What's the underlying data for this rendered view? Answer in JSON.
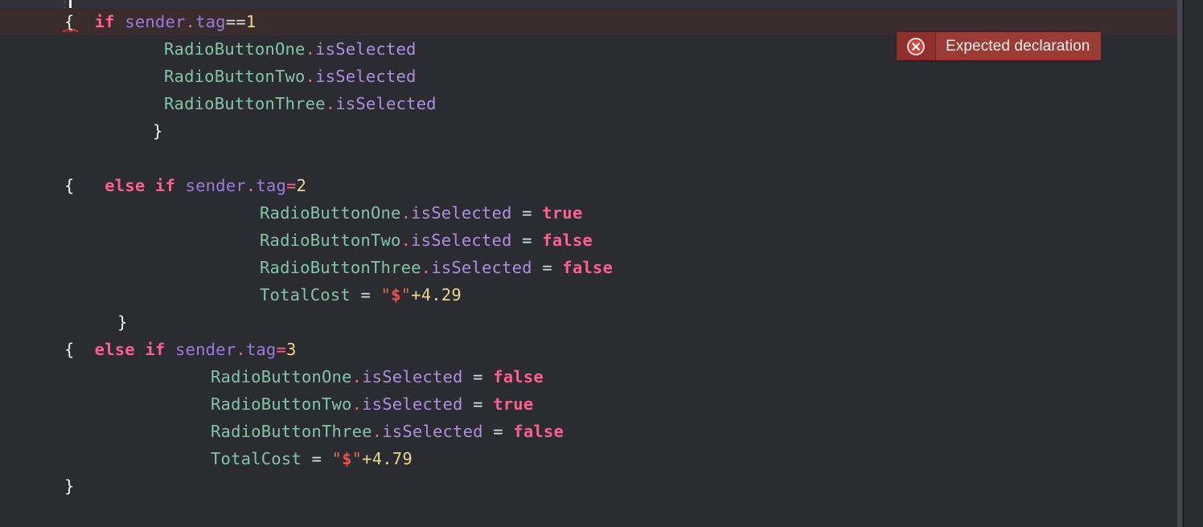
{
  "editor": {
    "background_color": "#2a2c31",
    "error_line_background": "#3a2b2d",
    "caret_color": "#f2f2f2"
  },
  "error_badge": {
    "icon": "error-circle-x-icon",
    "message": "Expected declaration",
    "icon_background": "#8f2f2c",
    "text_background": "#9a3b36",
    "text_color": "#fbeeed"
  },
  "code": {
    "language": "swift",
    "lines": [
      {
        "id": "line-1",
        "error": true,
        "indent": 0,
        "tokens": [
          {
            "t": "{",
            "c": "brace",
            "squiggle": true
          },
          {
            "t": "  ",
            "c": "plain"
          },
          {
            "t": "if",
            "c": "kw"
          },
          {
            "t": " ",
            "c": "plain"
          },
          {
            "t": "sender",
            "c": "ident"
          },
          {
            "t": ".",
            "c": "punct"
          },
          {
            "t": "tag",
            "c": "ident"
          },
          {
            "t": "==",
            "c": "op"
          },
          {
            "t": "1",
            "c": "num"
          }
        ]
      },
      {
        "id": "line-2",
        "error": false,
        "indent": 124,
        "tokens": [
          {
            "t": "RadioButtonOne",
            "c": "type"
          },
          {
            "t": ".",
            "c": "punct"
          },
          {
            "t": "isSelected",
            "c": "prop"
          }
        ]
      },
      {
        "id": "line-3",
        "error": false,
        "indent": 124,
        "tokens": [
          {
            "t": "RadioButtonTwo",
            "c": "type"
          },
          {
            "t": ".",
            "c": "punct"
          },
          {
            "t": "isSelected",
            "c": "prop"
          }
        ]
      },
      {
        "id": "line-4",
        "error": false,
        "indent": 124,
        "tokens": [
          {
            "t": "RadioButtonThree",
            "c": "type"
          },
          {
            "t": ".",
            "c": "punct"
          },
          {
            "t": "isSelected",
            "c": "prop"
          }
        ]
      },
      {
        "id": "line-5",
        "error": false,
        "indent": 110,
        "tokens": [
          {
            "t": "}",
            "c": "brace"
          }
        ]
      },
      {
        "id": "line-6",
        "error": false,
        "indent": 0,
        "tokens": []
      },
      {
        "id": "line-7",
        "error": false,
        "indent": 0,
        "tokens": [
          {
            "t": "{",
            "c": "brace"
          },
          {
            "t": "   ",
            "c": "plain"
          },
          {
            "t": "else",
            "c": "kw"
          },
          {
            "t": " ",
            "c": "plain"
          },
          {
            "t": "if",
            "c": "kw"
          },
          {
            "t": " ",
            "c": "plain"
          },
          {
            "t": "sender",
            "c": "ident"
          },
          {
            "t": ".",
            "c": "punct"
          },
          {
            "t": "tag",
            "c": "ident"
          },
          {
            "t": "=",
            "c": "punct"
          },
          {
            "t": "2",
            "c": "num"
          }
        ]
      },
      {
        "id": "line-8",
        "error": false,
        "indent": 243,
        "tokens": [
          {
            "t": "RadioButtonOne",
            "c": "type"
          },
          {
            "t": ".",
            "c": "punct"
          },
          {
            "t": "isSelected",
            "c": "prop"
          },
          {
            "t": " ",
            "c": "plain"
          },
          {
            "t": "=",
            "c": "op"
          },
          {
            "t": " ",
            "c": "plain"
          },
          {
            "t": "true",
            "c": "bool"
          }
        ]
      },
      {
        "id": "line-9",
        "error": false,
        "indent": 243,
        "tokens": [
          {
            "t": "RadioButtonTwo",
            "c": "type"
          },
          {
            "t": ".",
            "c": "punct"
          },
          {
            "t": "isSelected",
            "c": "prop"
          },
          {
            "t": " ",
            "c": "plain"
          },
          {
            "t": "=",
            "c": "op"
          },
          {
            "t": " ",
            "c": "plain"
          },
          {
            "t": "false",
            "c": "bool"
          }
        ]
      },
      {
        "id": "line-10",
        "error": false,
        "indent": 243,
        "tokens": [
          {
            "t": "RadioButtonThree",
            "c": "type"
          },
          {
            "t": ".",
            "c": "punct"
          },
          {
            "t": "isSelected",
            "c": "prop"
          },
          {
            "t": " ",
            "c": "plain"
          },
          {
            "t": "=",
            "c": "op"
          },
          {
            "t": " ",
            "c": "plain"
          },
          {
            "t": "false",
            "c": "bool"
          }
        ]
      },
      {
        "id": "line-11",
        "error": false,
        "indent": 243,
        "tokens": [
          {
            "t": "TotalCost",
            "c": "type"
          },
          {
            "t": " ",
            "c": "plain"
          },
          {
            "t": "=",
            "c": "op"
          },
          {
            "t": " ",
            "c": "plain"
          },
          {
            "t": "\"",
            "c": "str"
          },
          {
            "t": "$",
            "c": "dollar"
          },
          {
            "t": "\"",
            "c": "str"
          },
          {
            "t": "+4.29",
            "c": "num"
          }
        ]
      },
      {
        "id": "line-12",
        "error": false,
        "indent": 66,
        "tokens": [
          {
            "t": "}",
            "c": "brace"
          }
        ]
      },
      {
        "id": "line-13",
        "error": false,
        "indent": 0,
        "tokens": [
          {
            "t": "{",
            "c": "brace"
          },
          {
            "t": "  ",
            "c": "plain"
          },
          {
            "t": "else",
            "c": "kw"
          },
          {
            "t": " ",
            "c": "plain"
          },
          {
            "t": "if",
            "c": "kw"
          },
          {
            "t": " ",
            "c": "plain"
          },
          {
            "t": "sender",
            "c": "ident"
          },
          {
            "t": ".",
            "c": "punct"
          },
          {
            "t": "tag",
            "c": "ident"
          },
          {
            "t": "=",
            "c": "punct"
          },
          {
            "t": "3",
            "c": "num"
          }
        ]
      },
      {
        "id": "line-14",
        "error": false,
        "indent": 182,
        "tokens": [
          {
            "t": "RadioButtonOne",
            "c": "type"
          },
          {
            "t": ".",
            "c": "punct"
          },
          {
            "t": "isSelected",
            "c": "prop"
          },
          {
            "t": " ",
            "c": "plain"
          },
          {
            "t": "=",
            "c": "op"
          },
          {
            "t": " ",
            "c": "plain"
          },
          {
            "t": "false",
            "c": "bool"
          }
        ]
      },
      {
        "id": "line-15",
        "error": false,
        "indent": 182,
        "tokens": [
          {
            "t": "RadioButtonTwo",
            "c": "type"
          },
          {
            "t": ".",
            "c": "punct"
          },
          {
            "t": "isSelected",
            "c": "prop"
          },
          {
            "t": " ",
            "c": "plain"
          },
          {
            "t": "=",
            "c": "op"
          },
          {
            "t": " ",
            "c": "plain"
          },
          {
            "t": "true",
            "c": "bool"
          }
        ]
      },
      {
        "id": "line-16",
        "error": false,
        "indent": 182,
        "tokens": [
          {
            "t": "RadioButtonThree",
            "c": "type"
          },
          {
            "t": ".",
            "c": "punct"
          },
          {
            "t": "isSelected",
            "c": "prop"
          },
          {
            "t": " ",
            "c": "plain"
          },
          {
            "t": "=",
            "c": "op"
          },
          {
            "t": " ",
            "c": "plain"
          },
          {
            "t": "false",
            "c": "bool"
          }
        ]
      },
      {
        "id": "line-17",
        "error": false,
        "indent": 182,
        "tokens": [
          {
            "t": "TotalCost",
            "c": "type"
          },
          {
            "t": " ",
            "c": "plain"
          },
          {
            "t": "=",
            "c": "op"
          },
          {
            "t": " ",
            "c": "plain"
          },
          {
            "t": "\"",
            "c": "str"
          },
          {
            "t": "$",
            "c": "dollar"
          },
          {
            "t": "\"",
            "c": "str"
          },
          {
            "t": "+4.79",
            "c": "num"
          }
        ]
      },
      {
        "id": "line-18",
        "error": false,
        "indent": 0,
        "tokens": [
          {
            "t": "}",
            "c": "brace"
          }
        ]
      }
    ]
  }
}
